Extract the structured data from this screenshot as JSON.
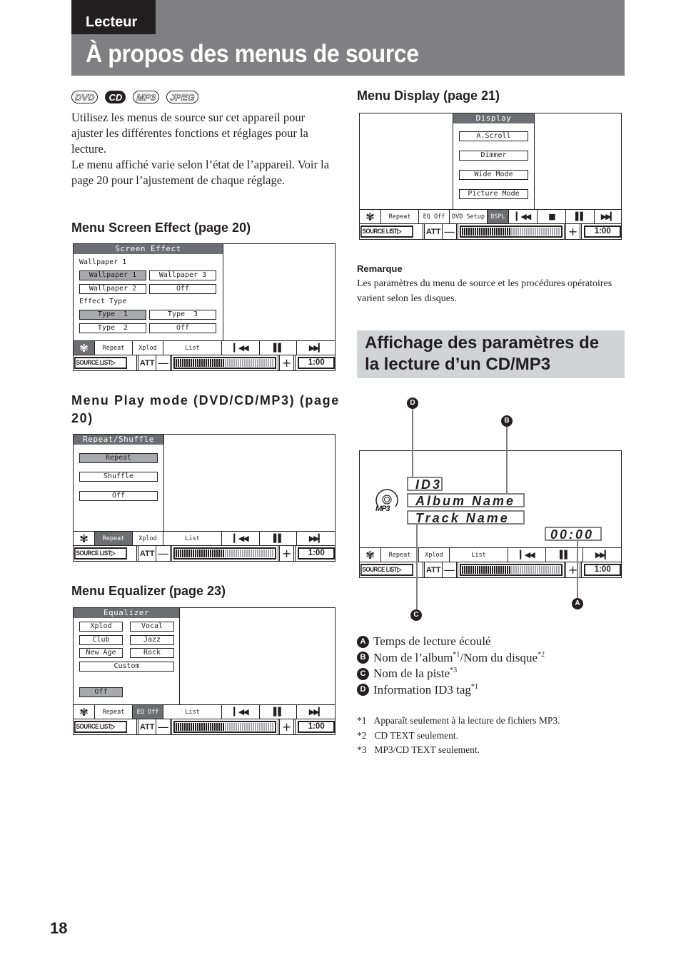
{
  "header": {
    "section_tab": "Lecteur",
    "title": "À propos des menus de source"
  },
  "media_icons": [
    "DVD",
    "CD",
    "MP3",
    "JPEG"
  ],
  "intro": {
    "para1": "Utilisez les menus de source sur cet appareil pour ajuster les différentes fonctions et réglages pour la lecture.",
    "para2": "Le menu affiché varie selon l’état de l’appareil. Voir la page 20 pour l’ajustement de chaque réglage."
  },
  "headings": {
    "screen_effect": "Menu Screen Effect (page 20)",
    "play_mode": "Menu Play mode (DVD/CD/MP3) (page 20)",
    "equalizer": "Menu Equalizer (page 23)",
    "display": "Menu Display (page 21)"
  },
  "common_bar": {
    "source_list": "SOURCE LIST▷",
    "att": "ATT",
    "minus": "—",
    "plus": "+",
    "time": "1:00",
    "volume_level_fraction": 0.5,
    "repeat": "Repeat",
    "xplod": "Xplod",
    "list": "List",
    "eq_off": "EQ Off",
    "dvd_setup": "DVD Setup",
    "dspl": "DSPL",
    "flower_icon": "✾",
    "prev_icon": "⏮",
    "pause_icon": "⏸",
    "stop_icon": "■",
    "next_icon": "⏭"
  },
  "screen_effect": {
    "title": "Screen Effect",
    "wallpaper_label": "Wallpaper 1",
    "wallpaper_buttons": [
      "Wallpaper 1",
      "Wallpaper 3",
      "Wallpaper 2",
      "Off"
    ],
    "effect_label": "Effect Type",
    "effect_buttons": [
      "Type  1",
      "Type  3",
      "Type  2",
      "Off"
    ]
  },
  "play_mode": {
    "title": "Repeat/Shuffle",
    "buttons": [
      "Repeat",
      "Shuffle",
      "Off"
    ]
  },
  "equalizer": {
    "title": "Equalizer",
    "buttons": [
      "Xplod",
      "Vocal",
      "Club",
      "Jazz",
      "New Age",
      "Rock",
      "Custom"
    ],
    "off": "Off"
  },
  "display_menu": {
    "title": "Display",
    "buttons": [
      "A.Scroll",
      "Dimmer",
      "Wide Mode",
      "Picture Mode"
    ]
  },
  "remarque": {
    "title": "Remarque",
    "text": "Les paramètres du menu de source et les procédures opératoires varient selon les disques."
  },
  "section2": {
    "title_line1": "Affichage des paramètres de",
    "title_line2": "la lecture d’un CD/MP3"
  },
  "cd_screen": {
    "disc_label": "MP3",
    "id3": "ID3",
    "album": "Album Name",
    "track": "Track Name",
    "elapsed": "00:00",
    "callouts": [
      "A",
      "B",
      "C",
      "D"
    ]
  },
  "legend": [
    {
      "key": "A",
      "text": "Temps de lecture écoulé",
      "sup": ""
    },
    {
      "key": "B",
      "text": "Nom de l’album",
      "sup": "*1",
      "text2": "/Nom du disque",
      "sup2": "*2"
    },
    {
      "key": "C",
      "text": "Nom de la piste",
      "sup": "*3"
    },
    {
      "key": "D",
      "text": "Information ID3 tag",
      "sup": "*1"
    }
  ],
  "footnotes": [
    {
      "key": "*1",
      "text": "Apparaît seulement à la lecture de fichiers MP3."
    },
    {
      "key": "*2",
      "text": "CD TEXT seulement."
    },
    {
      "key": "*3",
      "text": "MP3/CD TEXT seulement."
    }
  ],
  "page_number": "18"
}
